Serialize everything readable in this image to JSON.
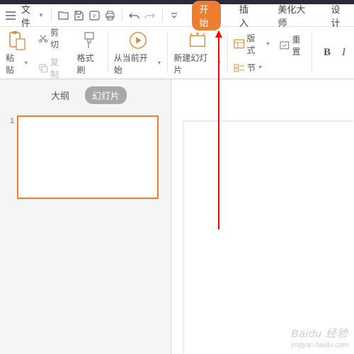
{
  "menubar": {
    "file_label": "文件",
    "tabs": [
      "开始",
      "插入",
      "美化大师",
      "设计"
    ]
  },
  "ribbon": {
    "paste_label": "粘贴",
    "cut_label": "剪切",
    "copy_label": "复制",
    "format_painter_label": "格式刷",
    "from_current_label": "从当前开始",
    "new_slide_label": "新建幻灯片",
    "layout_label": "版式",
    "section_label": "节",
    "reset_label": "重置"
  },
  "sidebar": {
    "outline_tab": "大纲",
    "slides_tab": "幻灯片",
    "slide_number": "1"
  },
  "watermark": {
    "brand": "Baidu 经验",
    "url": "jingyan.baidu.com"
  }
}
